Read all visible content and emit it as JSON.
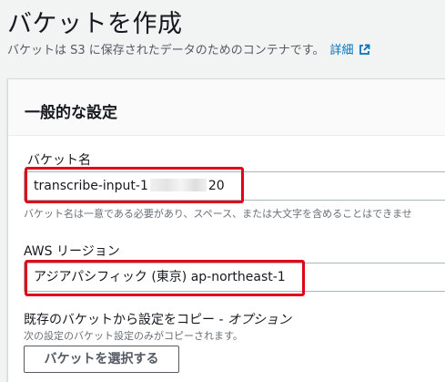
{
  "page": {
    "title": "バケットを作成",
    "description": "バケットは S3 に保存されたデータのためのコンテナです。",
    "info_link": "詳細",
    "info_icon": "external-link-icon"
  },
  "general": {
    "title": "一般的な設定",
    "bucket_name": {
      "label": "バケット名",
      "value_prefix": "transcribe-input-1",
      "value_suffix": "20",
      "hint": "バケット名は一意である必要があり、スペース、または大文字を含めることはできませ"
    },
    "region": {
      "label": "AWS リージョン",
      "value": "アジアパシフィック (東京) ap-northeast-1"
    },
    "copy": {
      "label": "既存のバケットから設定をコピー - ",
      "label_optional": "オプション",
      "hint": "次の設定のバケット設定のみがコピーされます。",
      "button": "バケットを選択する"
    }
  },
  "colors": {
    "highlight": "#e3001b",
    "link": "#0073bb"
  }
}
